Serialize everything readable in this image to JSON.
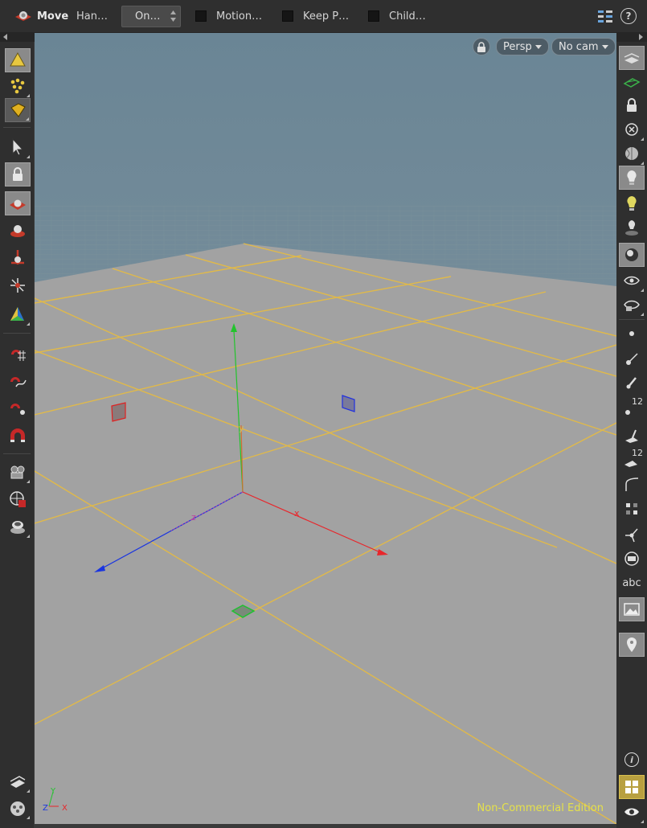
{
  "toolbar": {
    "tool_name": "Move",
    "handle_label": "Han…",
    "mode_dropdown": "On…",
    "motion_label": "Motion…",
    "keep_label": "Keep P…",
    "child_label": "Child…",
    "help_glyph": "?"
  },
  "viewport": {
    "persp_label": "Persp",
    "camera_label": "No cam",
    "edition_text": "Non-Commercial Edition",
    "axis_labels": {
      "x": "x",
      "y": "y",
      "z": "z"
    },
    "gnomon": {
      "x": "X",
      "y": "Y",
      "z": "Z"
    }
  },
  "right_toolbar": {
    "point_number_label": "12",
    "prim_number_label": "12",
    "text_label": "abc",
    "info_glyph": "i"
  },
  "colors": {
    "grid_line": "#e0b94a",
    "floor": "#a2a2a2",
    "sky_top": "#6c8898",
    "sky_bottom": "#8a9aa4",
    "axis_x": "#e8262b",
    "axis_y": "#22c42c",
    "axis_z": "#1a35e0",
    "edition_text": "#e5e14a"
  }
}
